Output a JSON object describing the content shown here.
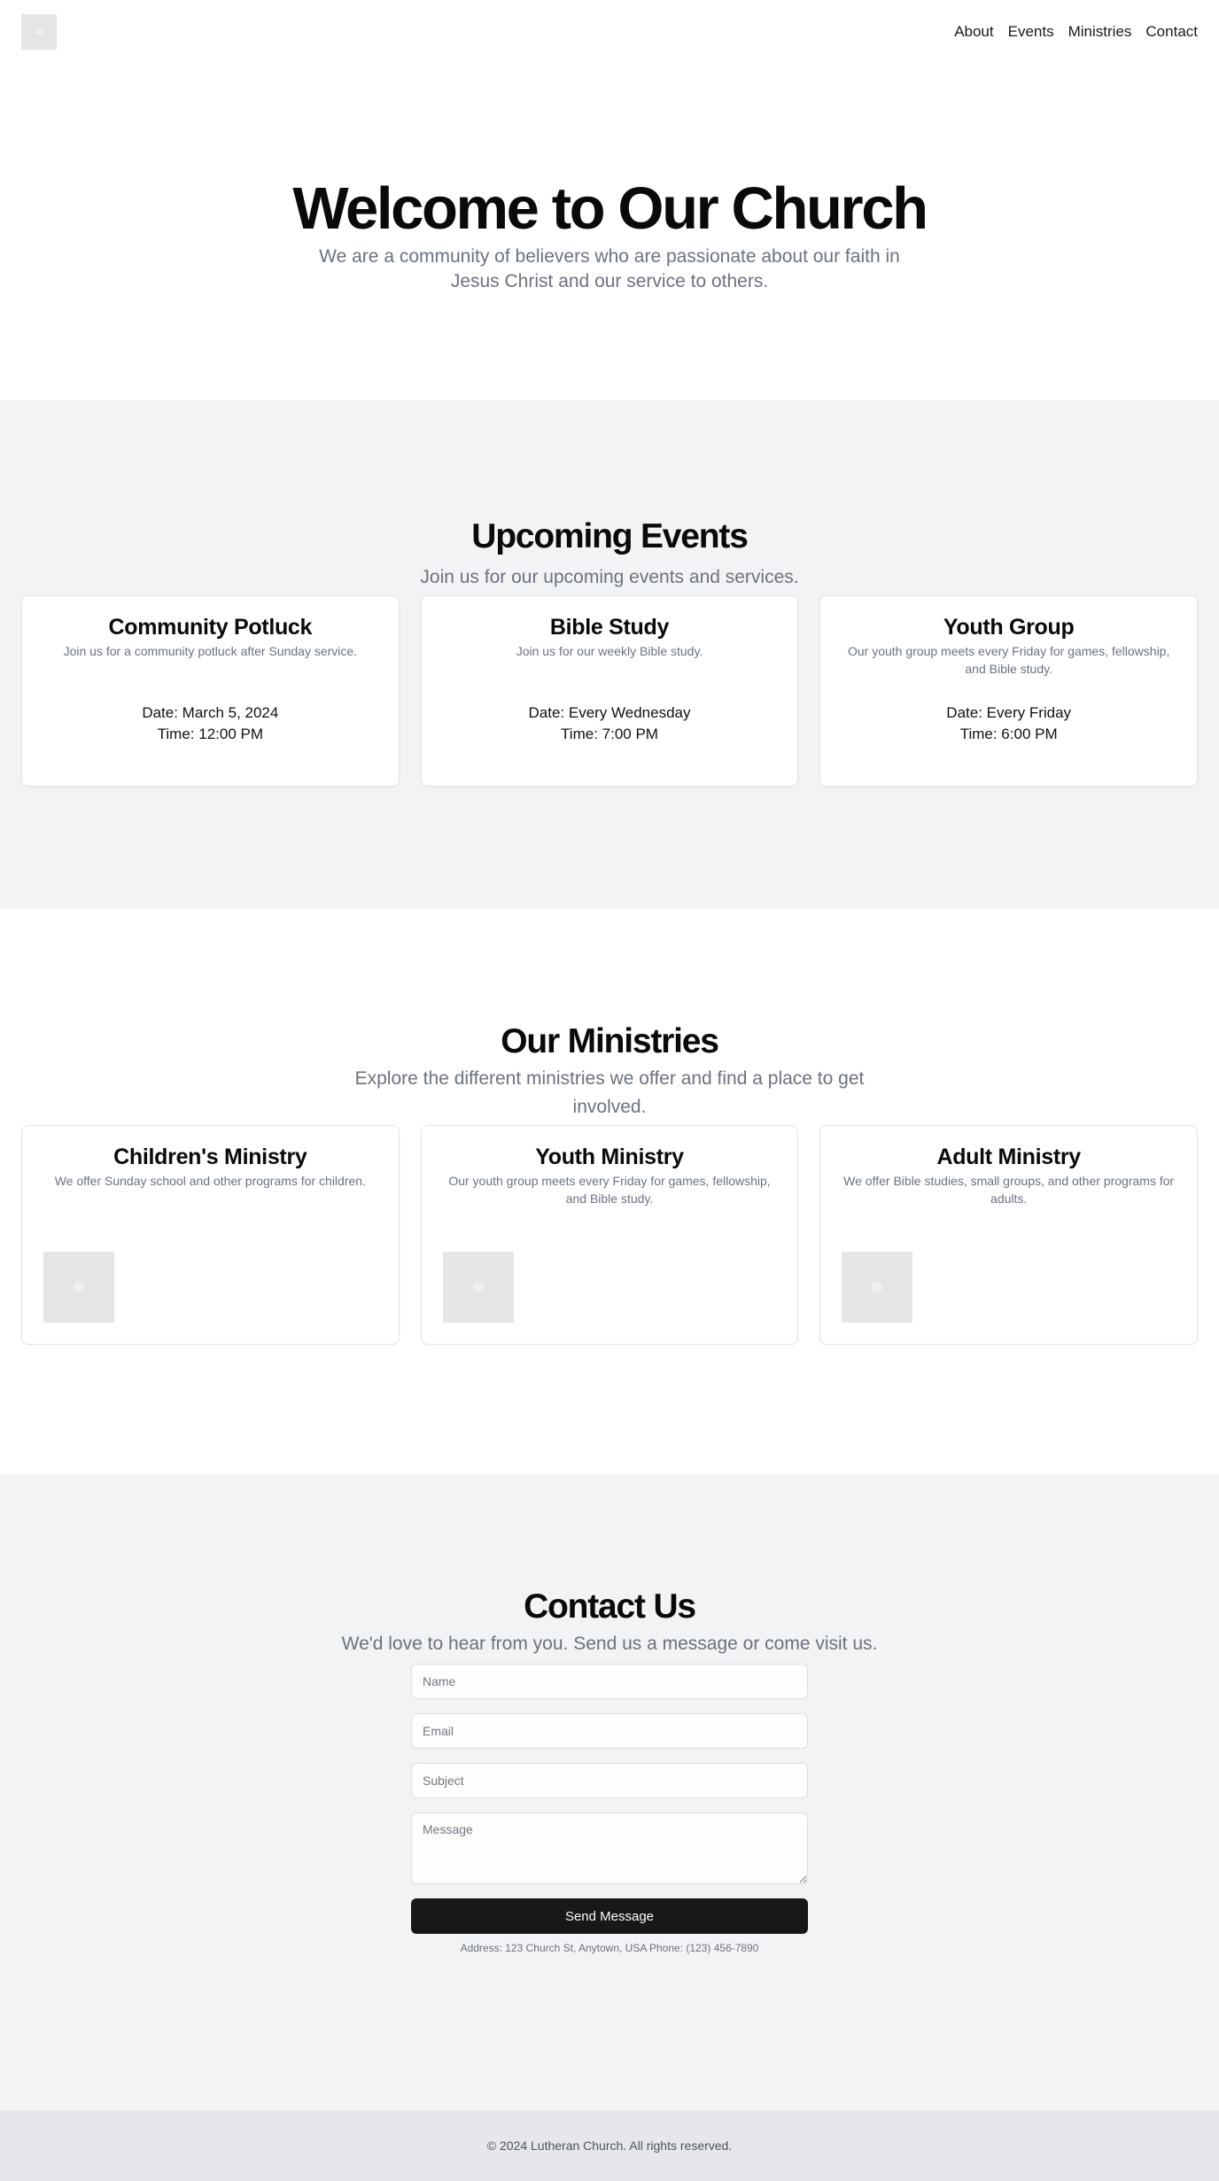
{
  "header": {
    "logo_icon": "image-placeholder-icon",
    "nav": [
      {
        "label": "About"
      },
      {
        "label": "Events"
      },
      {
        "label": "Ministries"
      },
      {
        "label": "Contact"
      }
    ]
  },
  "hero": {
    "title": "Welcome to Our Church",
    "subtitle": "We are a community of believers who are passionate about our faith in Jesus Christ and our service to others."
  },
  "events": {
    "title": "Upcoming Events",
    "subtitle": "Join us for our upcoming events and services.",
    "items": [
      {
        "title": "Community Potluck",
        "description": "Join us for a community potluck after Sunday service.",
        "date": "Date: March 5, 2024",
        "time": "Time: 12:00 PM"
      },
      {
        "title": "Bible Study",
        "description": "Join us for our weekly Bible study.",
        "date": "Date: Every Wednesday",
        "time": "Time: 7:00 PM"
      },
      {
        "title": "Youth Group",
        "description": "Our youth group meets every Friday for games, fellowship, and Bible study.",
        "date": "Date: Every Friday",
        "time": "Time: 6:00 PM"
      }
    ]
  },
  "ministries": {
    "title": "Our Ministries",
    "subtitle": "Explore the different ministries we offer and find a place to get involved.",
    "items": [
      {
        "title": "Children's Ministry",
        "description": "We offer Sunday school and other programs for children.",
        "image_icon": "image-placeholder-icon"
      },
      {
        "title": "Youth Ministry",
        "description": "Our youth group meets every Friday for games, fellowship, and Bible study.",
        "image_icon": "image-placeholder-icon"
      },
      {
        "title": "Adult Ministry",
        "description": "We offer Bible studies, small groups, and other programs for adults.",
        "image_icon": "image-placeholder-icon"
      }
    ]
  },
  "contact": {
    "title": "Contact Us",
    "subtitle": "We'd love to hear from you. Send us a message or come visit us.",
    "fields": {
      "name_placeholder": "Name",
      "email_placeholder": "Email",
      "subject_placeholder": "Subject",
      "message_placeholder": "Message"
    },
    "submit_label": "Send Message",
    "info": "Address: 123 Church St, Anytown, USA Phone: (123) 456-7890"
  },
  "footer": {
    "copyright": "© 2024 Lutheran Church. All rights reserved."
  },
  "colors": {
    "text": "#0a0a0a",
    "muted": "#6b7280",
    "section_gray": "#f2f3f5",
    "footer_bg": "#e5e7eb",
    "button_bg": "#18181b",
    "placeholder_box": "#e5e5e5"
  }
}
